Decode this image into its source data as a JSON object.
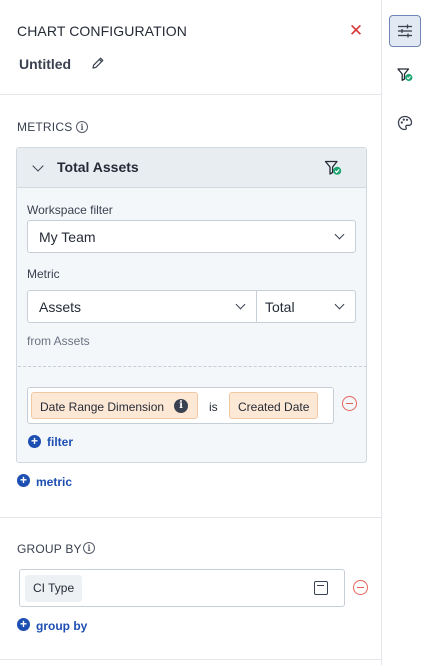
{
  "header": {
    "title": "CHART CONFIGURATION",
    "chart_name": "Untitled",
    "close_icon": "close-icon",
    "edit_icon": "pencil-icon"
  },
  "metrics": {
    "section_label": "METRICS",
    "card": {
      "title": "Total Assets",
      "workspace_filter_label": "Workspace filter",
      "workspace_filter_value": "My Team",
      "metric_label": "Metric",
      "metric_value": "Assets",
      "aggregation_value": "Total",
      "from_text": "from Assets",
      "filter": {
        "dimension": "Date Range Dimension",
        "operator": "is",
        "value": "Created Date"
      },
      "add_filter_label": "filter"
    },
    "add_metric_label": "metric"
  },
  "group_by": {
    "section_label": "GROUP BY",
    "item": "CI Type",
    "add_group_label": "group by"
  },
  "rail": {
    "items": [
      "sliders-icon",
      "filter-check-icon",
      "palette-icon"
    ]
  },
  "colors": {
    "accent_blue": "#1d4fb3",
    "close_red": "#d83a3a",
    "remove_red": "#e5645a",
    "filter_green": "#1ea672",
    "chip_orange": "#fde8d6"
  }
}
